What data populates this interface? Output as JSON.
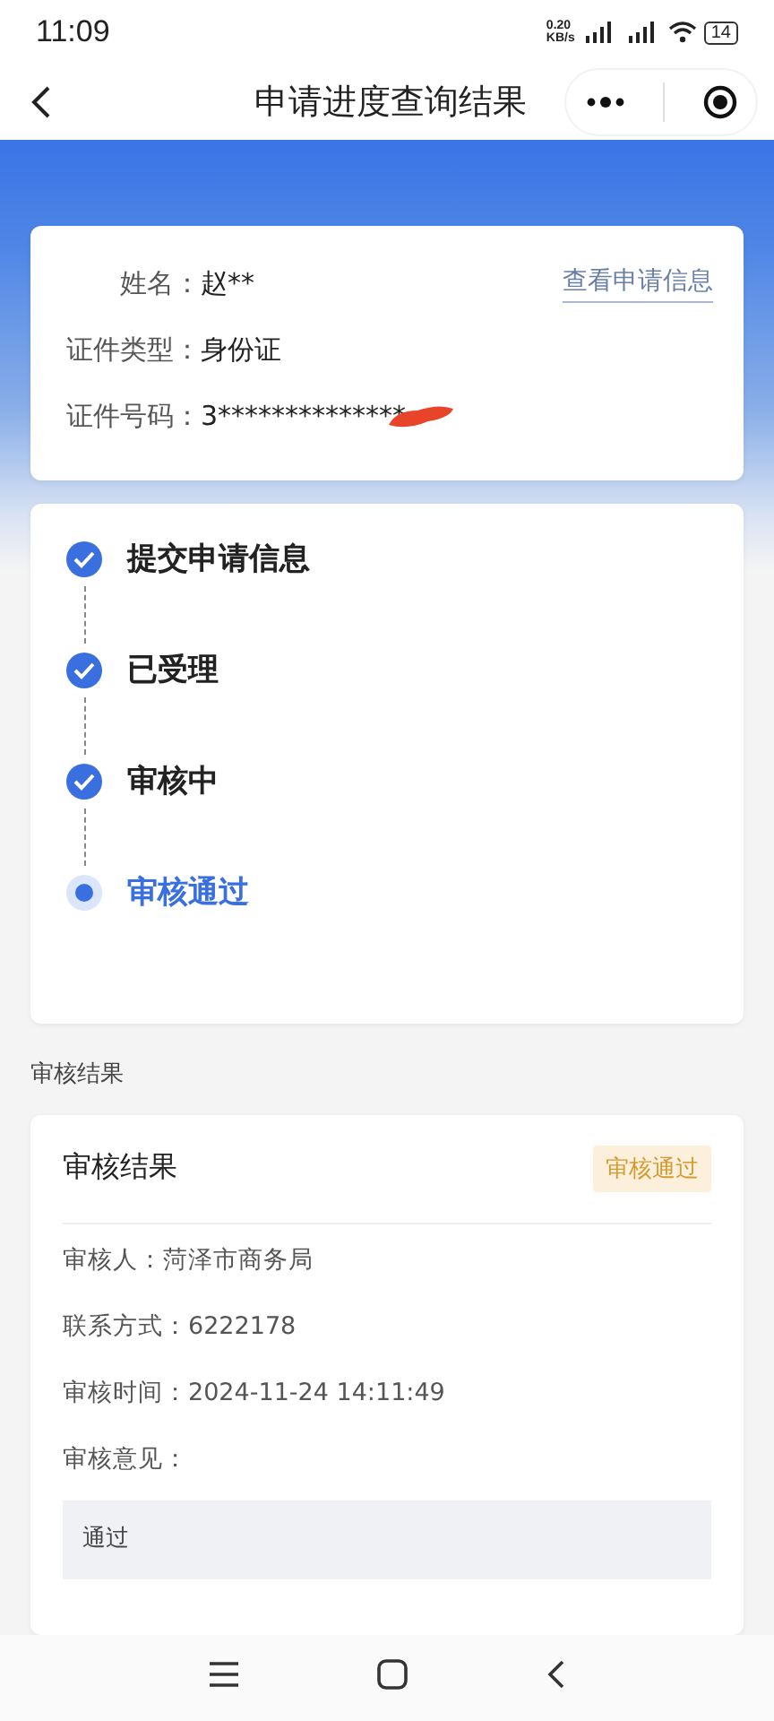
{
  "status_bar": {
    "time": "11:09",
    "speed": "0.20",
    "speed_unit": "KB/s",
    "battery": "14"
  },
  "nav": {
    "title": "申请进度查询结果"
  },
  "applicant": {
    "fields": [
      {
        "label": "姓名：",
        "value": "赵**",
        "redacted": false
      },
      {
        "label": "证件类型：",
        "value": "身份证",
        "redacted": false
      },
      {
        "label": "证件号码：",
        "value": "3**************",
        "redacted": true
      }
    ],
    "link": "查看申请信息"
  },
  "steps": [
    {
      "label": "提交申请信息",
      "done": true
    },
    {
      "label": "已受理",
      "done": true
    },
    {
      "label": "审核中",
      "done": true
    },
    {
      "label": "审核通过",
      "done": false
    }
  ],
  "section_title": "审核结果",
  "result": {
    "title": "审核结果",
    "badge": "审核通过",
    "rows": [
      "审核人：菏泽市商务局",
      "联系方式：6222178",
      "审核时间：2024-11-24 14:11:49",
      "审核意见："
    ],
    "comment": "通过"
  }
}
